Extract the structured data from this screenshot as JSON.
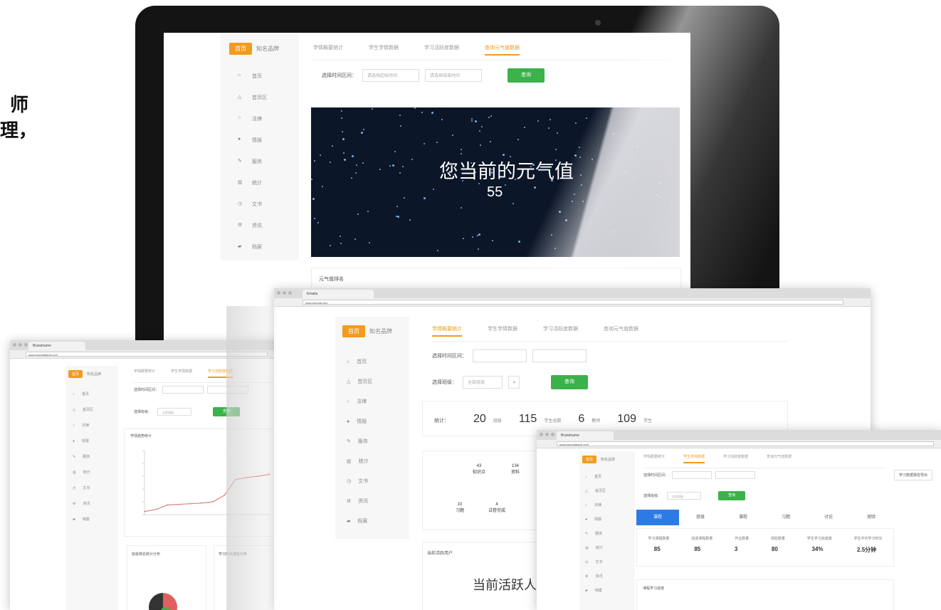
{
  "side_text": [
    "师",
    "理，"
  ],
  "brand": {
    "badge": "首页",
    "name": "知名品牌"
  },
  "nav": [
    "首页",
    "首页区",
    "法律",
    "情报",
    "服务",
    "统计",
    "文书",
    "资讯",
    "档案"
  ],
  "tabs": [
    "学情概要统计",
    "学生学情数据",
    "学习活跃度数据",
    "查询元气值数据"
  ],
  "monitor": {
    "filter_label": "选择时间区间：",
    "start_placeholder": "请选择起始时间",
    "end_placeholder": "请选择结束时间",
    "query_button": "查询",
    "banner_title": "您当前的元气值",
    "banner_value": "55",
    "section_title": "元气值排名"
  },
  "main_window": {
    "tab_label": "Emaila",
    "url": "www.annotta.com",
    "filter_label": "选择时间区间：",
    "range_label": "选择班级：",
    "range_value": "全部班级",
    "query_button": "查询",
    "stats_label": "统计：",
    "stats": [
      {
        "value": "20",
        "unit": "班级"
      },
      {
        "value": "115",
        "unit": "学生总数"
      },
      {
        "value": "6",
        "unit": "教师"
      },
      {
        "value": "109",
        "unit": "学生"
      }
    ],
    "mini_stats": [
      {
        "value": "43",
        "label": "知识点"
      },
      {
        "value": "134",
        "label": "资料"
      }
    ],
    "mini_stats2": [
      {
        "value": "10",
        "label": "习题"
      },
      {
        "value": "4",
        "label": "试卷完成"
      }
    ],
    "active_title": "当前活跃用户",
    "active_text": "当前活跃人"
  },
  "left_window": {
    "tab_label": "Brandname",
    "url": "www.annotatiepoll.com",
    "filter_label": "选择时间区间：",
    "select_label": "选择班级：",
    "select_value": "全部班级",
    "query_button": "查询",
    "chart_title": "学情趋势统计",
    "card1_title": "班级排名统计分布",
    "card2_title": "学习时长排名分布"
  },
  "right_window": {
    "tab_label": "Brandname",
    "url": "www.annotatiepoll.com",
    "filter_label": "选择时间区间：",
    "select_label": "选择班级：",
    "select_value": "全部班级",
    "query_button": "查询",
    "export_button": "学习数据报告导出",
    "subtabs": [
      "课程",
      "班级",
      "课程",
      "习题",
      "讨论",
      "测验"
    ],
    "metric_labels": [
      "学习课程数量",
      "完成课程数量",
      "作业数量",
      "测验数量",
      "学生学习完成度",
      "学生平均学习时长"
    ],
    "metric_values": [
      "85",
      "85",
      "3",
      "80",
      "34%",
      "2.5分钟"
    ],
    "section_title": "课程学习进度"
  },
  "colors": {
    "accent": "#f39a1f",
    "green": "#3bb24a",
    "chart_line": "#e08080"
  },
  "chart_data": {
    "type": "line",
    "x": [
      "1",
      "2",
      "3",
      "4",
      "5",
      "6",
      "7",
      "8",
      "9",
      "10",
      "11",
      "12"
    ],
    "series": [
      {
        "values": [
          5,
          8,
          15,
          16,
          17,
          18,
          20,
          30,
          55,
          58,
          60,
          63
        ]
      }
    ],
    "ylim": [
      0,
      100
    ]
  }
}
